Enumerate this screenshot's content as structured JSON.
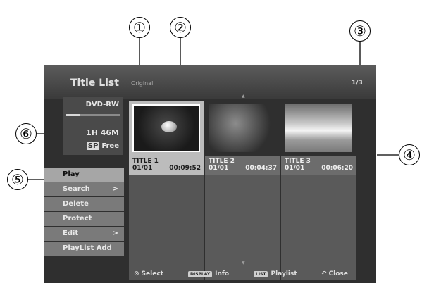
{
  "screen": {
    "title": "Title List",
    "subtitle": "Original",
    "page_count": "1/3"
  },
  "disc": {
    "type": "DVD-RW",
    "used_fraction": 0.25,
    "remaining_time": "1H 46M",
    "mode_badge": "SP",
    "mode_label": "Free"
  },
  "menu": {
    "items": [
      {
        "label": "Play",
        "selected": true
      },
      {
        "label": "Search",
        "submenu": ">"
      },
      {
        "label": "Delete"
      },
      {
        "label": "Protect"
      },
      {
        "label": "Edit",
        "submenu": ">"
      },
      {
        "label": "PlayList Add"
      }
    ]
  },
  "titles": [
    {
      "name": "TITLE 1",
      "date": "01/01",
      "duration": "00:09:52",
      "selected": true
    },
    {
      "name": "TITLE 2",
      "date": "01/01",
      "duration": "00:04:37"
    },
    {
      "name": "TITLE 3",
      "date": "01/01",
      "duration": "00:06:20"
    }
  ],
  "footer": {
    "select_icon": "⊙",
    "select_label": "Select",
    "info_key": "DISPLAY",
    "info_label": "Info",
    "playlist_key": "LIST",
    "playlist_label": "Playlist",
    "close_icon": "↶",
    "close_label": "Close"
  },
  "callouts": [
    "①",
    "②",
    "③",
    "④",
    "⑤",
    "⑥"
  ]
}
